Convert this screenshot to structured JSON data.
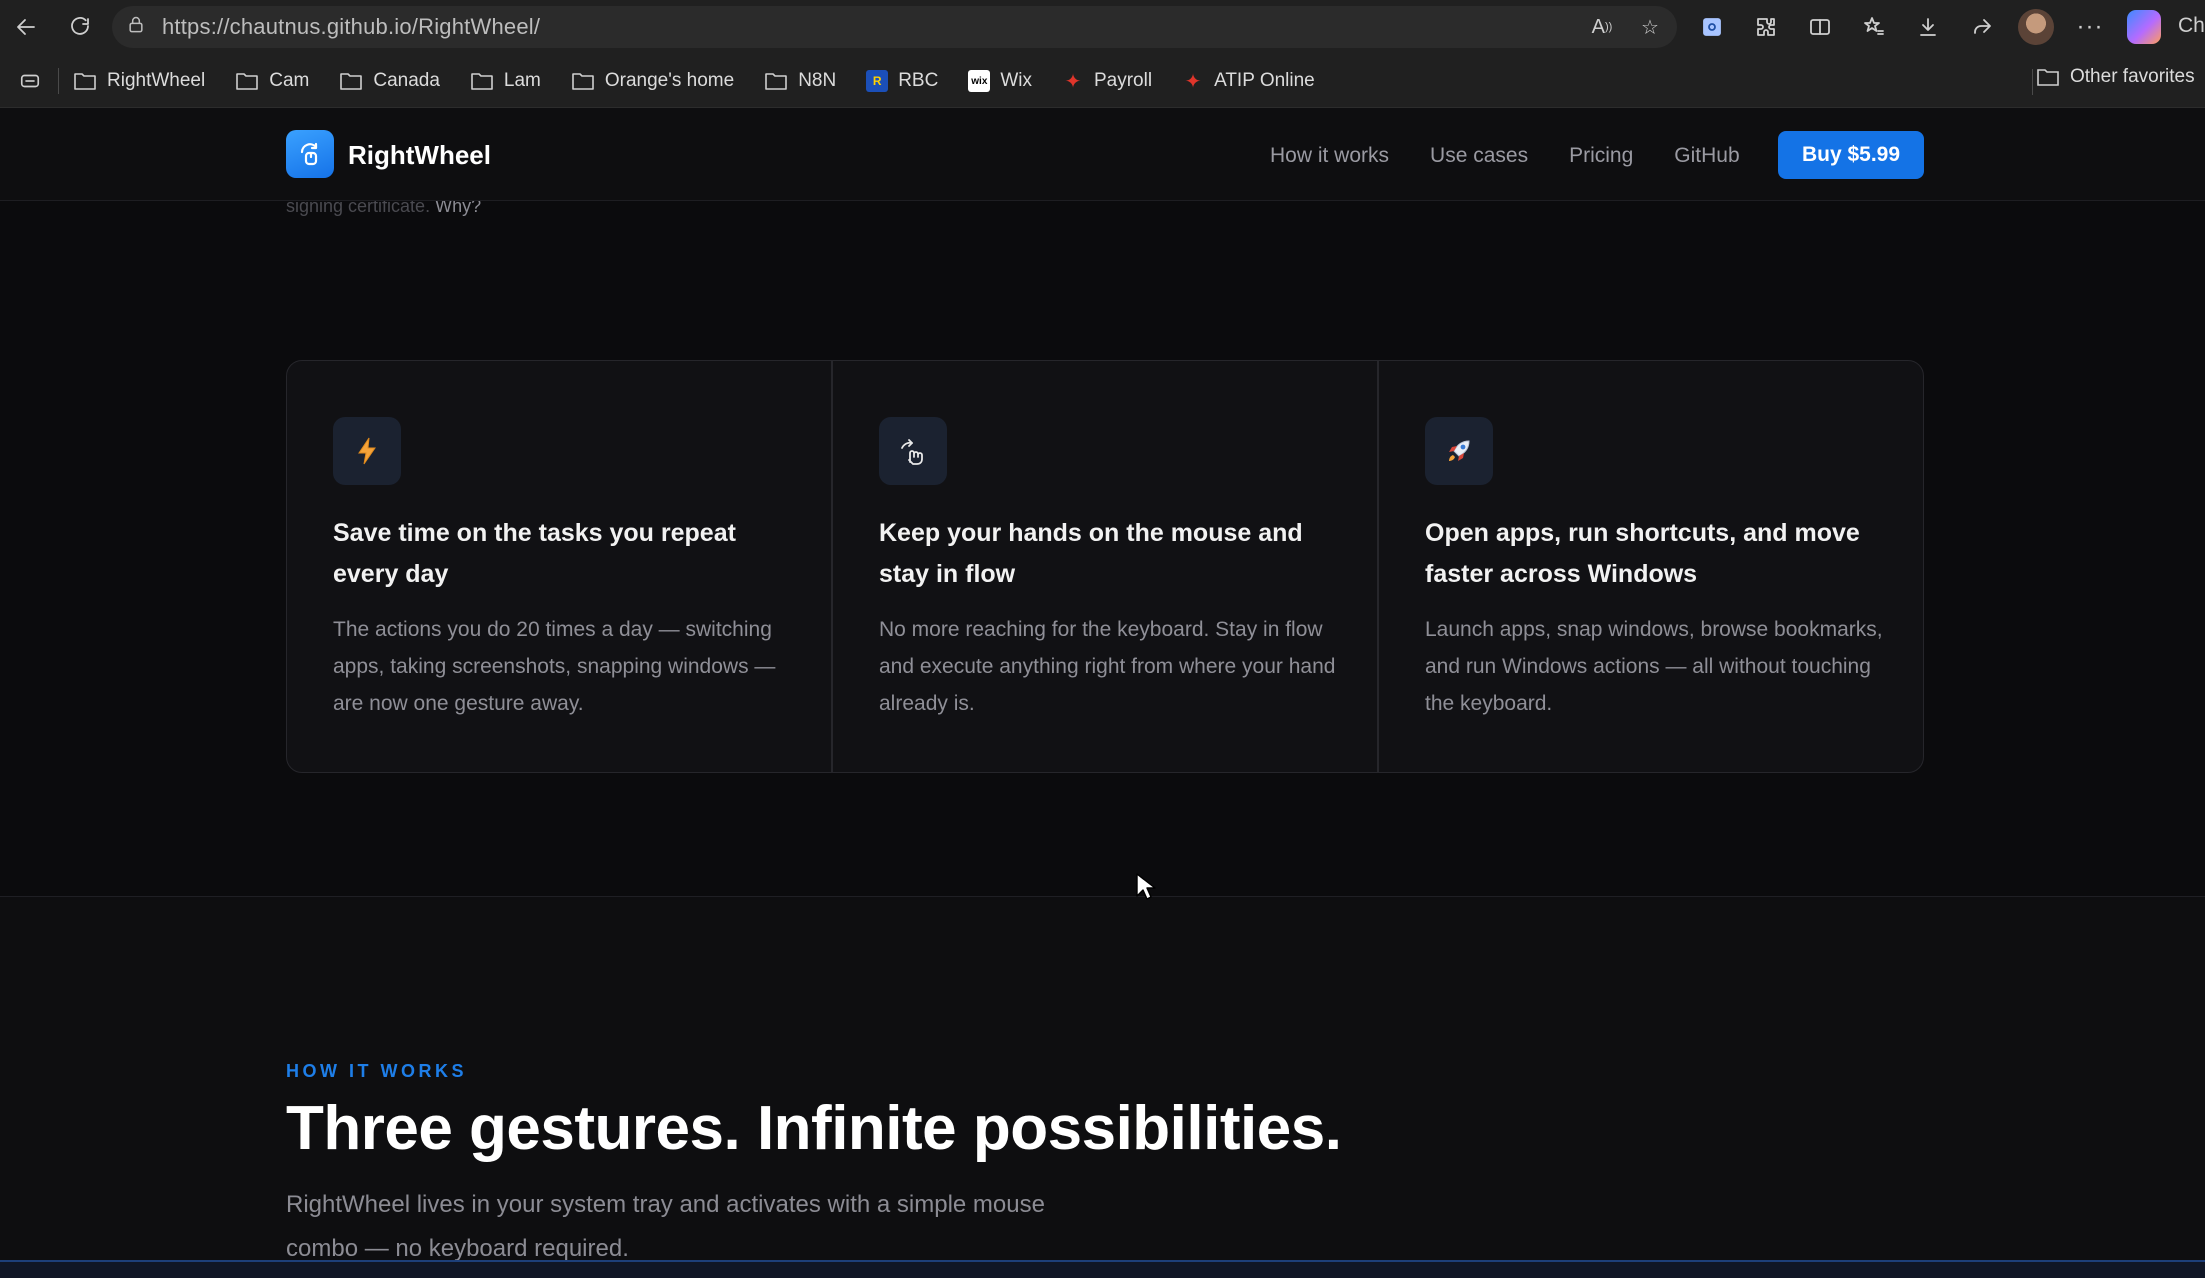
{
  "browser": {
    "url": "https://chautnus.github.io/RightWheel/",
    "profile_label_cut": "Cha",
    "bookmarks": [
      {
        "label": "RightWheel",
        "icon": "folder-icon"
      },
      {
        "label": "Cam",
        "icon": "folder-icon"
      },
      {
        "label": "Canada",
        "icon": "folder-icon"
      },
      {
        "label": "Lam",
        "icon": "folder-icon"
      },
      {
        "label": "Orange's home",
        "icon": "folder-icon"
      },
      {
        "label": "N8N",
        "icon": "folder-icon"
      },
      {
        "label": "RBC",
        "icon": "rbc-icon"
      },
      {
        "label": "Wix",
        "icon": "wix-icon"
      },
      {
        "label": "Payroll",
        "icon": "maple-leaf-icon"
      },
      {
        "label": "ATIP Online",
        "icon": "maple-leaf-icon"
      }
    ],
    "other_favorites": "Other favorites"
  },
  "nav": {
    "brand": "RightWheel",
    "links": [
      "How it works",
      "Use cases",
      "Pricing",
      "GitHub"
    ],
    "buy_label": "Buy $5.99",
    "accent": "#1473e6"
  },
  "faded": {
    "text": "signing certificate. ",
    "link": "Why?"
  },
  "features": [
    {
      "icon": "lightning-icon",
      "title": "Save time on the tasks you repeat every day",
      "body": "The actions you do 20 times a day — switching apps, taking screenshots, snapping windows — are now one gesture away."
    },
    {
      "icon": "hand-gesture-icon",
      "title": "Keep your hands on the mouse and stay in flow",
      "body": "No more reaching for the keyboard. Stay in flow and execute anything right from where your hand already is."
    },
    {
      "icon": "rocket-icon",
      "title": "Open apps, run shortcuts, and move faster across Windows",
      "body": "Launch apps, snap windows, browse bookmarks, and run Windows actions — all without touching the keyboard."
    }
  ],
  "how_it_works": {
    "eyebrow": "HOW IT WORKS",
    "headline": "Three gestures. Infinite possibilities.",
    "lead": "RightWheel lives in your system tray and activates with a simple mouse combo — no keyboard required."
  }
}
